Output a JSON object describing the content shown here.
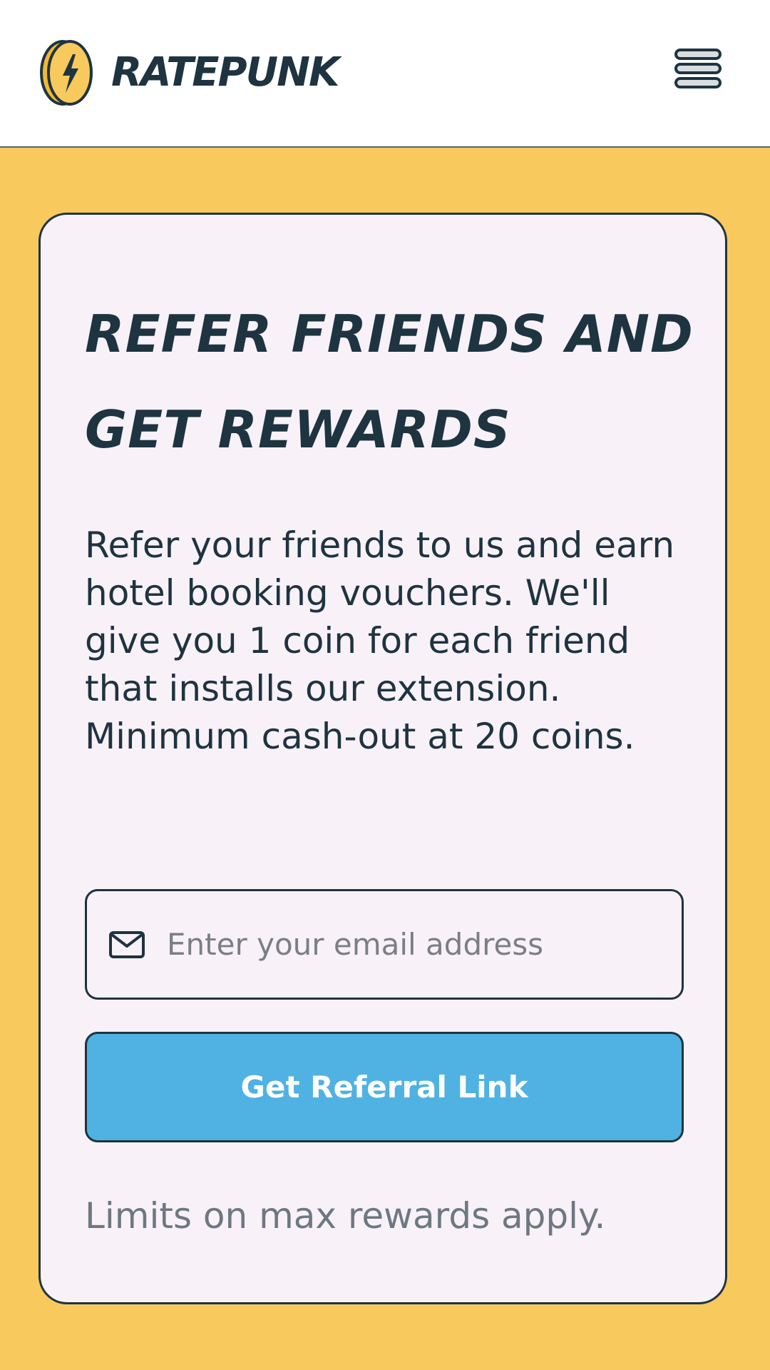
{
  "header": {
    "brand_name": "RATEPUNK",
    "logo_icon": "lightning-coin-icon",
    "menu_icon": "hamburger-menu-icon"
  },
  "referral_card": {
    "title": "REFER FRIENDS AND GET REWARDS",
    "description": "Refer your friends to us and earn hotel booking vouchers. We'll give you 1 coin for each friend that installs our extension. Minimum cash-out at 20 coins.",
    "email_field": {
      "icon": "mail-icon",
      "value": "",
      "placeholder": "Enter your email address"
    },
    "cta_label": "Get Referral Link",
    "footnote": "Limits on max rewards apply."
  },
  "colors": {
    "page_background": "#f8c95d",
    "card_background": "#f8f1f8",
    "text_dark": "#1e3440",
    "button_blue": "#4fb2e3",
    "muted_text": "#6d7880"
  }
}
